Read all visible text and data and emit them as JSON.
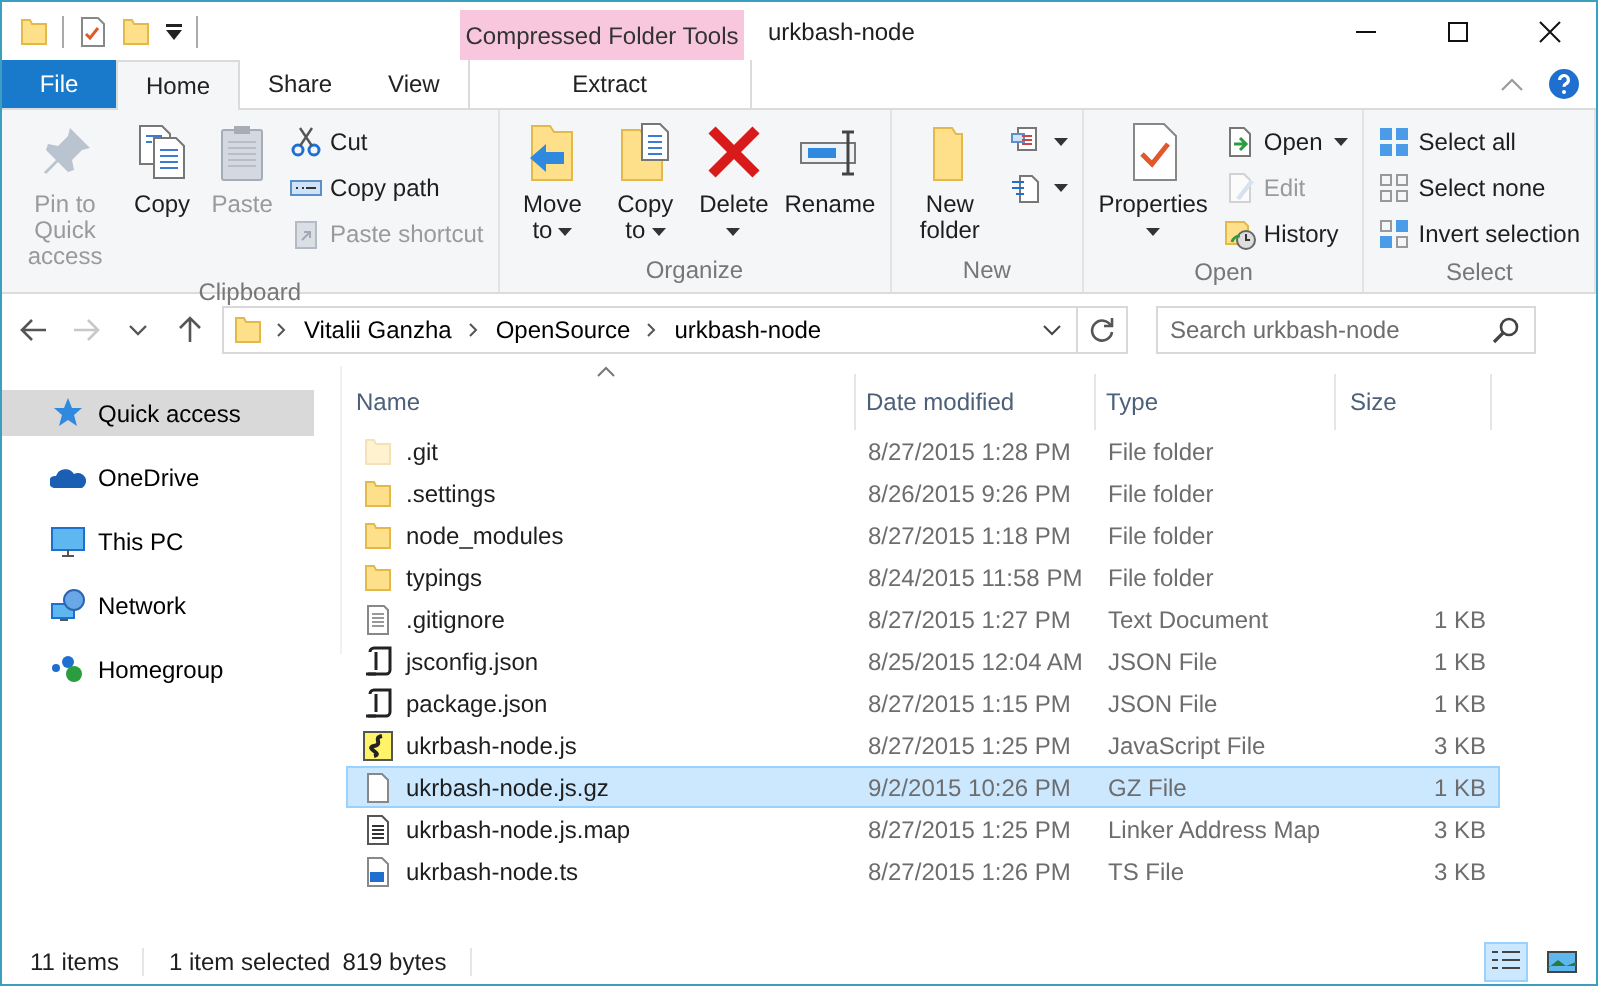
{
  "window": {
    "title": "urkbash-node"
  },
  "context_tab_group": {
    "label": "Compressed Folder Tools"
  },
  "tabs": [
    {
      "label": "File",
      "kind": "file",
      "selected": false
    },
    {
      "label": "Home",
      "kind": "normal",
      "selected": true
    },
    {
      "label": "Share",
      "kind": "normal",
      "selected": false
    },
    {
      "label": "View",
      "kind": "normal",
      "selected": false
    },
    {
      "label": "Extract",
      "kind": "context",
      "selected": false
    }
  ],
  "ribbon_groups": [
    {
      "label": "Clipboard",
      "items": [
        {
          "kind": "large",
          "label": "Pin to Quick access",
          "disabled": true,
          "dropdown": false
        },
        {
          "kind": "large",
          "label": "Copy",
          "disabled": false,
          "dropdown": false
        },
        {
          "kind": "large",
          "label": "Paste",
          "disabled": true,
          "dropdown": false
        },
        {
          "kind": "small",
          "label": "Cut",
          "disabled": false,
          "dropdown": false
        },
        {
          "kind": "small",
          "label": "Copy path",
          "disabled": false,
          "dropdown": false
        },
        {
          "kind": "small",
          "label": "Paste shortcut",
          "disabled": true,
          "dropdown": false
        }
      ]
    },
    {
      "label": "Organize",
      "items": [
        {
          "kind": "large",
          "label": "Move to",
          "disabled": false,
          "dropdown": true
        },
        {
          "kind": "large",
          "label": "Copy to",
          "disabled": false,
          "dropdown": true
        },
        {
          "kind": "large",
          "label": "Delete",
          "disabled": false,
          "dropdown": true
        },
        {
          "kind": "large",
          "label": "Rename",
          "disabled": false,
          "dropdown": false
        }
      ]
    },
    {
      "label": "New",
      "items": [
        {
          "kind": "large",
          "label": "New folder",
          "disabled": false,
          "dropdown": false
        },
        {
          "kind": "small",
          "disabled": false,
          "dropdown": true
        },
        {
          "kind": "small",
          "disabled": false,
          "dropdown": true
        }
      ]
    },
    {
      "label": "Open",
      "items": [
        {
          "kind": "large",
          "label": "Properties",
          "disabled": false,
          "dropdown": true
        },
        {
          "kind": "small",
          "label": "Open",
          "disabled": false,
          "dropdown": true
        },
        {
          "kind": "small",
          "label": "Edit",
          "disabled": true,
          "dropdown": false
        },
        {
          "kind": "small",
          "label": "History",
          "disabled": false,
          "dropdown": false
        }
      ]
    },
    {
      "label": "Select",
      "items": [
        {
          "kind": "small",
          "label": "Select all",
          "disabled": false,
          "dropdown": false
        },
        {
          "kind": "small",
          "label": "Select none",
          "disabled": false,
          "dropdown": false
        },
        {
          "kind": "small",
          "label": "Invert selection",
          "disabled": false,
          "dropdown": false
        }
      ]
    }
  ],
  "nav_buttons": [
    {
      "kind": "back",
      "disabled": false
    },
    {
      "kind": "forward",
      "disabled": true
    },
    {
      "kind": "recent",
      "disabled": false
    },
    {
      "kind": "up",
      "disabled": false
    }
  ],
  "address": {
    "path": [
      "Vitalii Ganzha",
      "OpenSource",
      "urkbash-node"
    ]
  },
  "search": {
    "placeholder": "Search urkbash-node"
  },
  "navigation_pane": [
    {
      "label": "Quick access",
      "kind": "quick",
      "selected": true
    },
    {
      "label": "OneDrive",
      "kind": "cloud",
      "selected": false
    },
    {
      "label": "This PC",
      "kind": "pc",
      "selected": false
    },
    {
      "label": "Network",
      "kind": "network",
      "selected": false
    },
    {
      "label": "Homegroup",
      "kind": "homegroup",
      "selected": false
    }
  ],
  "columns": [
    {
      "label": "Name",
      "sorted": true
    },
    {
      "label": "Date modified"
    },
    {
      "label": "Type"
    },
    {
      "label": "Size"
    }
  ],
  "files": [
    {
      "name": ".git",
      "date": "8/27/2015 1:28 PM",
      "type": "File folder",
      "kind": "folder",
      "hidden": true,
      "selected": false
    },
    {
      "name": ".settings",
      "date": "8/26/2015 9:26 PM",
      "type": "File folder",
      "kind": "folder",
      "hidden": false,
      "selected": false
    },
    {
      "name": "node_modules",
      "date": "8/27/2015 1:18 PM",
      "type": "File folder",
      "kind": "folder",
      "hidden": false,
      "selected": false
    },
    {
      "name": "typings",
      "date": "8/24/2015 11:58 PM",
      "type": "File folder",
      "kind": "folder",
      "hidden": false,
      "selected": false
    },
    {
      "name": ".gitignore",
      "date": "8/27/2015 1:27 PM",
      "type": "Text Document",
      "size": "1 KB",
      "kind": "text",
      "hidden": false,
      "selected": false
    },
    {
      "name": "jsconfig.json",
      "date": "8/25/2015 12:04 AM",
      "type": "JSON File",
      "size": "1 KB",
      "kind": "json",
      "hidden": false,
      "selected": false
    },
    {
      "name": "package.json",
      "date": "8/27/2015 1:15 PM",
      "type": "JSON File",
      "size": "1 KB",
      "kind": "json",
      "hidden": false,
      "selected": false
    },
    {
      "name": "ukrbash-node.js",
      "date": "8/27/2015 1:25 PM",
      "type": "JavaScript File",
      "size": "3 KB",
      "kind": "script",
      "hidden": false,
      "selected": false
    },
    {
      "name": "ukrbash-node.js.gz",
      "date": "9/2/2015 10:26 PM",
      "type": "GZ File",
      "size": "1 KB",
      "kind": "blank",
      "hidden": false,
      "selected": true
    },
    {
      "name": "ukrbash-node.js.map",
      "date": "8/27/2015 1:25 PM",
      "type": "Linker Address Map",
      "size": "3 KB",
      "kind": "map",
      "hidden": false,
      "selected": false
    },
    {
      "name": "ukrbash-node.ts",
      "date": "8/27/2015 1:26 PM",
      "type": "TS File",
      "size": "3 KB",
      "kind": "ts",
      "hidden": false,
      "selected": false
    }
  ],
  "status_bar": {
    "item_count": "11 items",
    "selection": "1 item selected",
    "selection_size": "819 bytes",
    "view_buttons": [
      {
        "kind": "details",
        "selected": true
      },
      {
        "kind": "thumbnails",
        "selected": false
      }
    ]
  }
}
